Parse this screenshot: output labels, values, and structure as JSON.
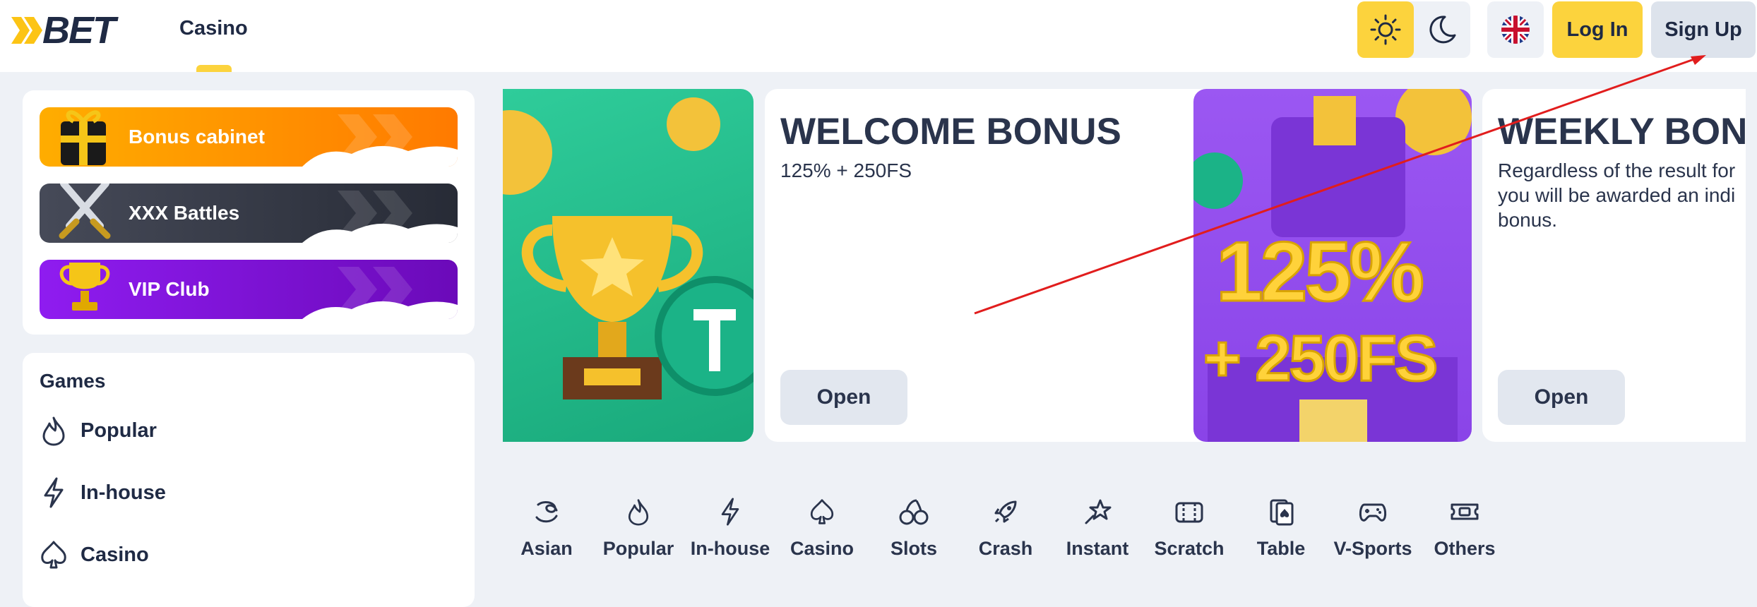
{
  "header": {
    "logo_text": "BET",
    "nav_casino": "Casino",
    "theme": {
      "light_icon": "sun-icon",
      "dark_icon": "moon-icon",
      "active": "light"
    },
    "language_icon": "uk-flag-icon",
    "login_label": "Log In",
    "signup_label": "Sign Up"
  },
  "sidebar": {
    "promos": [
      {
        "label": "Bonus cabinet",
        "icon": "gift-box-icon"
      },
      {
        "label": "XXX Battles",
        "icon": "crossed-swords-icon"
      },
      {
        "label": "VIP Club",
        "icon": "trophy-icon"
      }
    ],
    "games": {
      "title": "Games",
      "items": [
        {
          "label": "Popular",
          "icon": "flame-icon"
        },
        {
          "label": "In-house",
          "icon": "lightning-icon"
        },
        {
          "label": "Casino",
          "icon": "spade-icon"
        }
      ]
    }
  },
  "banners": [
    {
      "title": "WELCOME BONUS",
      "subtitle": "125% + 250FS",
      "button": "Open"
    },
    {
      "title": "WEEKLY BONU",
      "subtitle": "Regardless of the result for you will be awarded an indi bonus.",
      "button": "Open"
    }
  ],
  "banner_art": {
    "pct": "125%",
    "fs": "+ 250FS"
  },
  "categories": [
    {
      "label": "Asian",
      "icon": "asian-icon"
    },
    {
      "label": "Popular",
      "icon": "flame-icon"
    },
    {
      "label": "In-house",
      "icon": "lightning-icon"
    },
    {
      "label": "Casino",
      "icon": "spade-icon"
    },
    {
      "label": "Slots",
      "icon": "cherries-icon"
    },
    {
      "label": "Crash",
      "icon": "rocket-icon"
    },
    {
      "label": "Instant",
      "icon": "star-hand-icon"
    },
    {
      "label": "Scratch",
      "icon": "scratch-ticket-icon"
    },
    {
      "label": "Table",
      "icon": "cards-icon"
    },
    {
      "label": "V-Sports",
      "icon": "gamepad-icon"
    },
    {
      "label": "Others",
      "icon": "ticket-icon"
    }
  ],
  "colors": {
    "accent": "#fcd33d",
    "text": "#1f2a44",
    "page_bg": "#eef1f6"
  }
}
